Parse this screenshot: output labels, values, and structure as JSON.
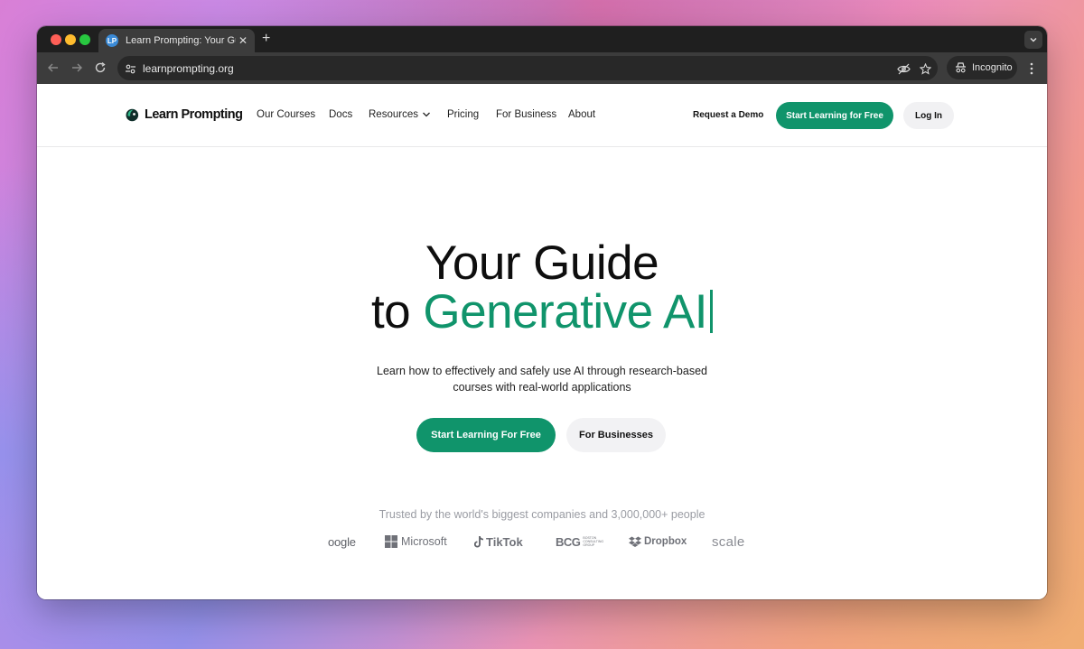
{
  "browser": {
    "tab_title": "Learn Prompting: Your Guide",
    "tab_favicon_text": "LP",
    "url": "learnprompting.org",
    "incognito_label": "Incognito"
  },
  "site": {
    "logo_text": "Learn Prompting",
    "nav": [
      "Our Courses",
      "Docs",
      "Resources",
      "Pricing",
      "For Business",
      "About"
    ],
    "request_demo": "Request a Demo",
    "cta_primary": "Start Learning for Free",
    "cta_login": "Log In"
  },
  "hero": {
    "line1": "Your Guide",
    "line2_prefix": "to",
    "line2_accent": "Generative AI",
    "subtitle": "Learn how to effectively and safely use AI through research-based courses with real-world applications",
    "btn_primary": "Start Learning For Free",
    "btn_secondary": "For Businesses"
  },
  "trusted": {
    "text": "Trusted by the world's biggest companies and 3,000,000+ people",
    "logos": [
      "oogle",
      "Microsoft",
      "TikTok",
      "BCG",
      "Dropbox",
      "scale"
    ],
    "bcg_subtext": "BOSTON CONSULTING GROUP"
  },
  "colors": {
    "accent": "#10946b",
    "browser_frame": "#1f1f1f",
    "toolbar": "#3c3c3c"
  }
}
